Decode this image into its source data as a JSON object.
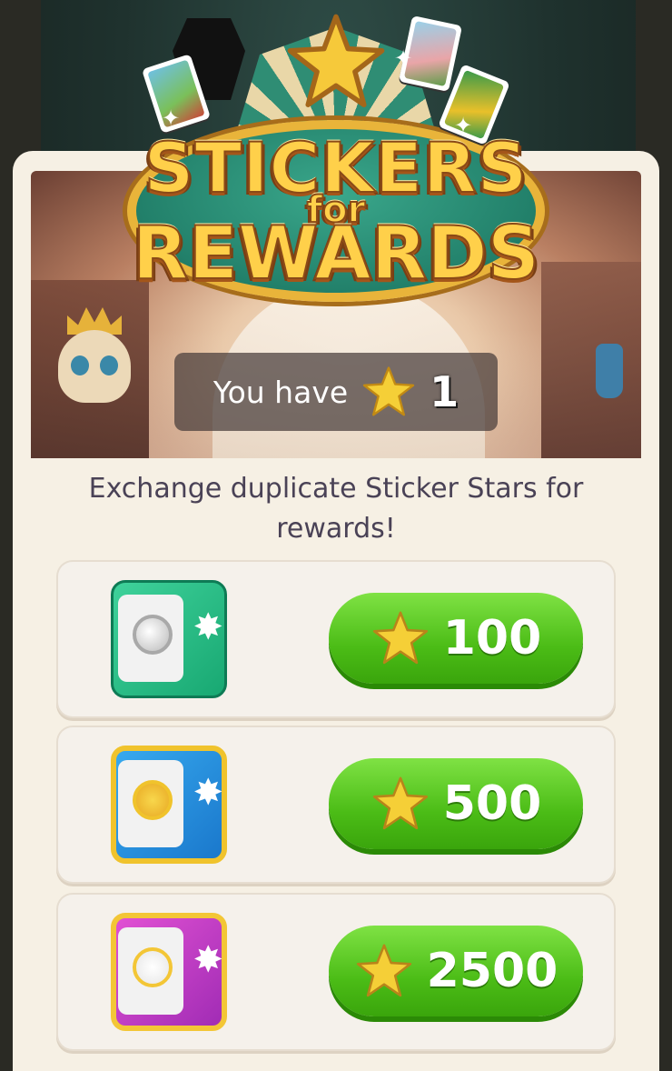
{
  "header": {
    "title_line1": "STICKERS",
    "title_line2": "for",
    "title_line3": "REWARDS"
  },
  "balance": {
    "label": "You have",
    "icon": "star-icon",
    "count": "1"
  },
  "description": "Exchange duplicate Sticker Stars for rewards!",
  "rewards": [
    {
      "safe": "green-vault-icon",
      "icon": "star-icon",
      "price": "100"
    },
    {
      "safe": "blue-vault-icon",
      "icon": "star-icon",
      "price": "500"
    },
    {
      "safe": "pink-vault-icon",
      "icon": "star-icon",
      "price": "2500"
    }
  ],
  "colors": {
    "button_green": "#4bbc16",
    "panel": "#f6f0e4",
    "text": "#4a4256",
    "star": "#f2c12e"
  }
}
